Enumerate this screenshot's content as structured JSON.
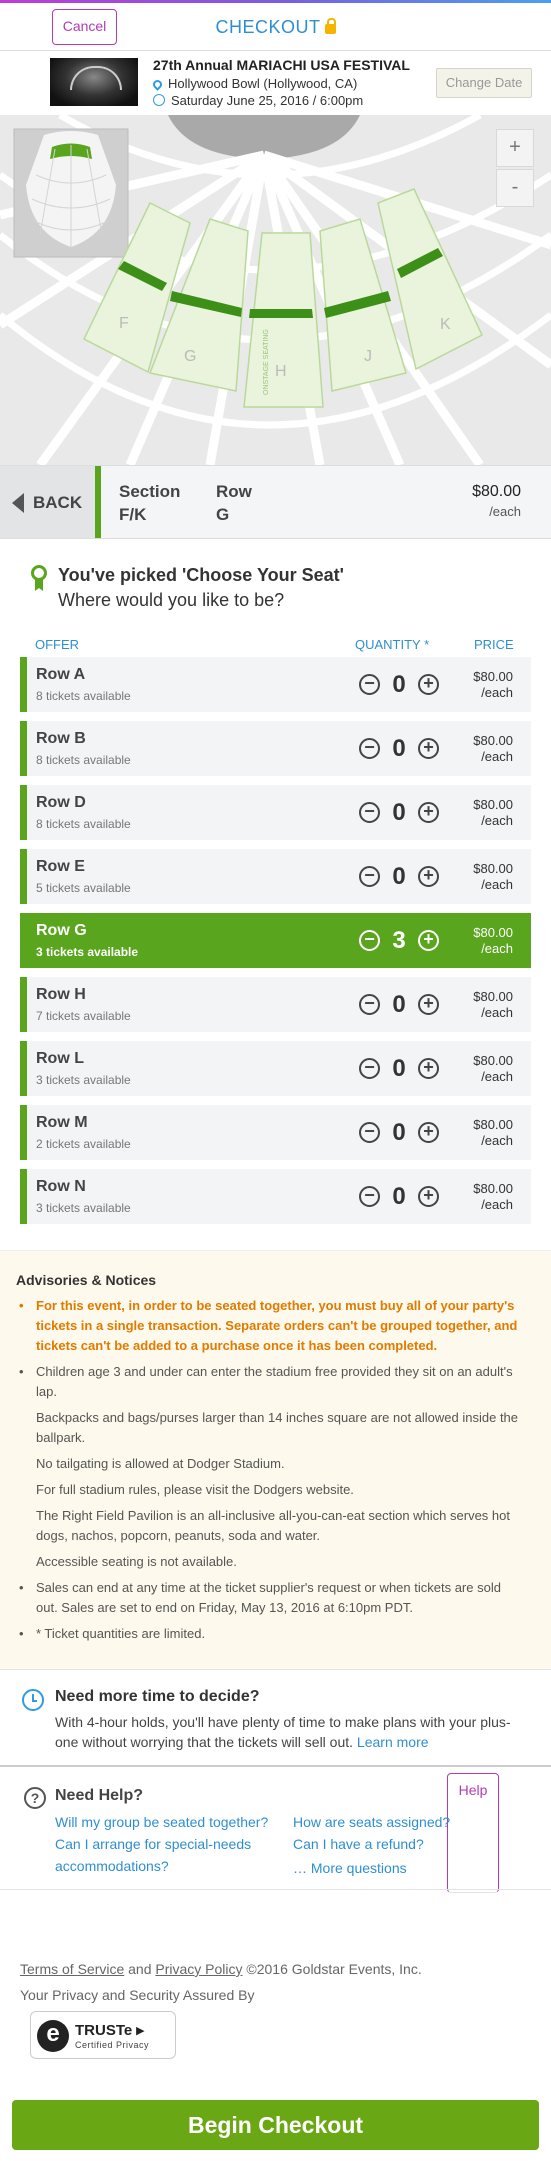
{
  "header": {
    "cancel_label": "Cancel",
    "title": "CHECKOUT",
    "help_label": "Help"
  },
  "event": {
    "title": "27th Annual MARIACHI USA FESTIVAL",
    "venue": "Hollywood Bowl (Hollywood, CA)",
    "date": "Saturday June 25, 2016 / 6:00pm",
    "change_date_label": "Change Date"
  },
  "map": {
    "zoom_in": "+",
    "zoom_out": "-",
    "section_labels": [
      "F",
      "G",
      "H",
      "J",
      "K"
    ],
    "aisle_label": "ONSTAGE SEATING"
  },
  "selection": {
    "back_label": "BACK",
    "section_label": "Section",
    "section_value": "F/K",
    "row_label": "Row",
    "row_value": "G",
    "price": "$80.00",
    "price_unit": "/each"
  },
  "picked": {
    "title": "You've picked 'Choose Your Seat'",
    "subtitle": "Where would you like to be?"
  },
  "table": {
    "col_offer": "OFFER",
    "col_quantity": "QUANTITY *",
    "col_price": "PRICE",
    "rows": [
      {
        "name": "Row A",
        "avail": "8 tickets available",
        "qty": "0",
        "price": "$80.00",
        "unit": "/each"
      },
      {
        "name": "Row B",
        "avail": "8 tickets available",
        "qty": "0",
        "price": "$80.00",
        "unit": "/each"
      },
      {
        "name": "Row D",
        "avail": "8 tickets available",
        "qty": "0",
        "price": "$80.00",
        "unit": "/each"
      },
      {
        "name": "Row E",
        "avail": "5 tickets available",
        "qty": "0",
        "price": "$80.00",
        "unit": "/each"
      },
      {
        "name": "Row G",
        "avail": "3 tickets available",
        "qty": "3",
        "price": "$80.00",
        "unit": "/each"
      },
      {
        "name": "Row H",
        "avail": "7 tickets available",
        "qty": "0",
        "price": "$80.00",
        "unit": "/each"
      },
      {
        "name": "Row L",
        "avail": "3 tickets available",
        "qty": "0",
        "price": "$80.00",
        "unit": "/each"
      },
      {
        "name": "Row M",
        "avail": "2 tickets available",
        "qty": "0",
        "price": "$80.00",
        "unit": "/each"
      },
      {
        "name": "Row N",
        "avail": "3 tickets available",
        "qty": "0",
        "price": "$80.00",
        "unit": "/each"
      }
    ],
    "selected_row": "Row G"
  },
  "advisories": {
    "heading": "Advisories & Notices",
    "warning": "For this event, in order to be seated together, you must buy all of your party's tickets in a single transaction. Separate orders can't be grouped together, and tickets can't be added to a purchase once it has been completed.",
    "children": "Children age 3 and under can enter the stadium free provided they sit on an adult's lap.",
    "bags": "Backpacks and bags/purses larger than 14 inches square are not allowed inside the ballpark.",
    "tailgating": "No tailgating is allowed at Dodger Stadium.",
    "rules": "For full stadium rules, please visit the Dodgers website.",
    "pavilion": "The Right Field Pavilion is an all-inclusive all-you-can-eat section which serves hot dogs, nachos, popcorn, peanuts, soda and water.",
    "accessible": "Accessible seating is not available.",
    "sales": "Sales can end at any time at the ticket supplier's request or when tickets are sold out. Sales are set to end on Friday, May 13, 2016 at 6:10pm PDT.",
    "limited": "* Ticket quantities are limited."
  },
  "more_time": {
    "heading": "Need more time to decide?",
    "body": "With 4-hour holds, you'll have plenty of time to make plans with your plus-one without worrying that the tickets will sell out.",
    "link": "Learn more"
  },
  "help_section": {
    "heading": "Need Help?",
    "q1": "Will my group be seated together?",
    "q2": "Can I arrange for special-needs accommodations?",
    "q3": "How are seats assigned?",
    "q4": "Can I have a refund?",
    "q5": "… More questions"
  },
  "footer": {
    "terms": "Terms of Service",
    "and": "and",
    "privacy": "Privacy Policy",
    "copyright": "©2016 Goldstar Events, Inc.",
    "assured": "Your Privacy and Security Assured By",
    "truste_name": "TRUSTe",
    "truste_sub": "Certified Privacy"
  },
  "checkout_label": "Begin Checkout",
  "colors": {
    "accent_green": "#5aa51e",
    "link_blue": "#2e8fd0",
    "brand_purple": "#b43bb8",
    "warning_orange": "#e07b00"
  }
}
